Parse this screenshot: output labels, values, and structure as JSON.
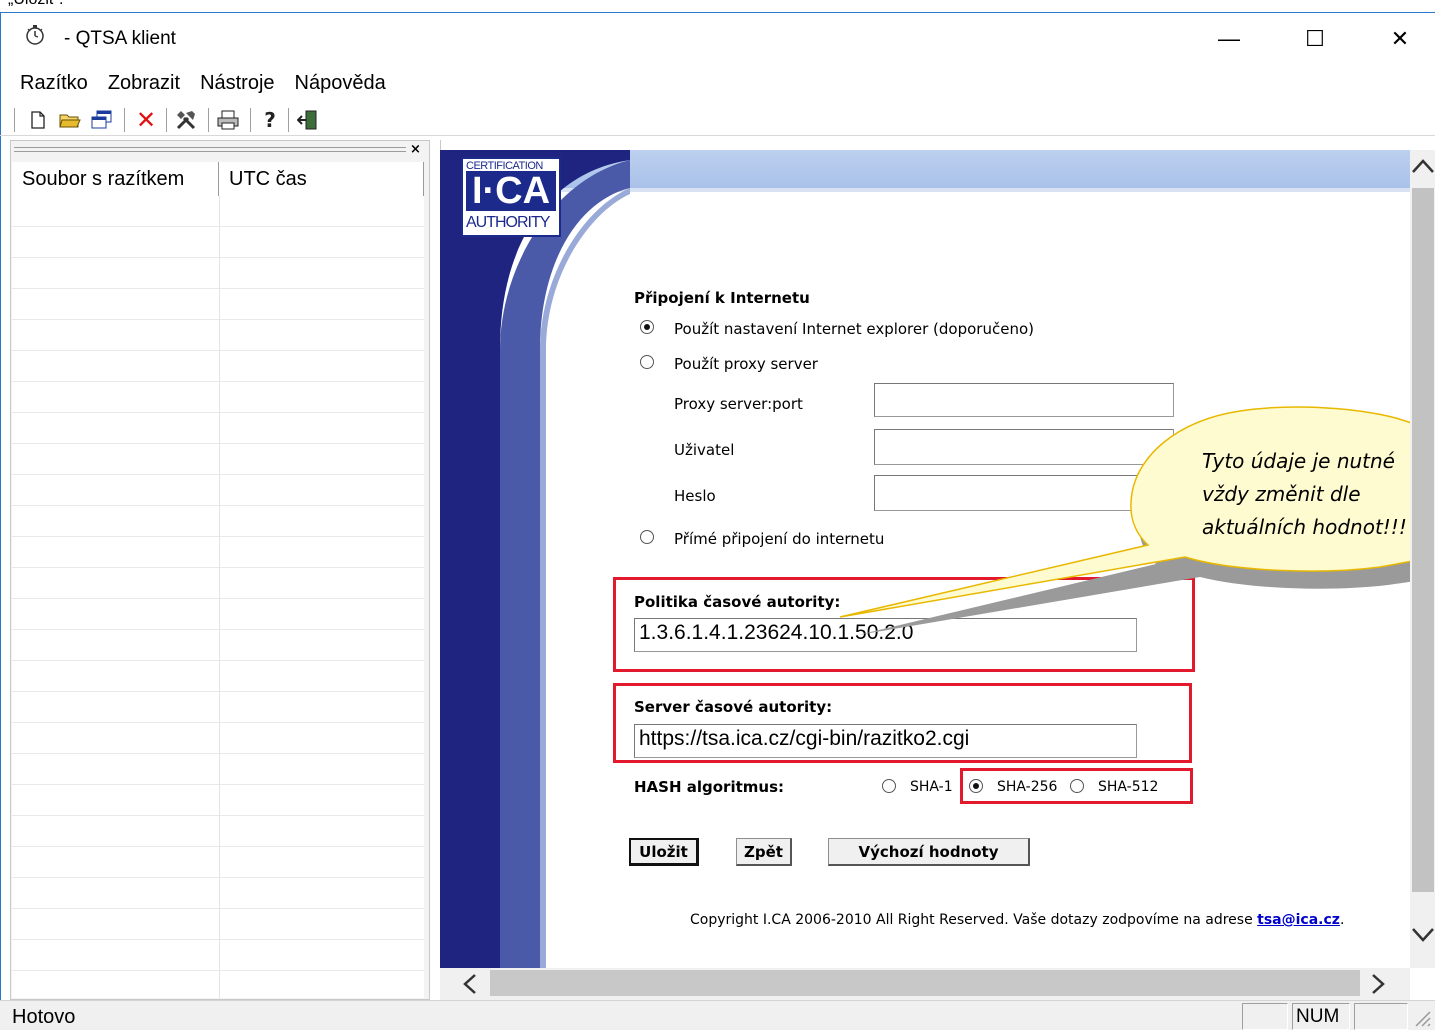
{
  "top_caption": "„Uložit\".",
  "window": {
    "title": "- QTSA klient",
    "controls": {
      "minimize": "—",
      "maximize": "☐",
      "close": "✕"
    }
  },
  "menu": [
    "Razítko",
    "Zobrazit",
    "Nástroje",
    "Nápověda"
  ],
  "toolbar_icons": [
    "new-document-icon",
    "open-folder-icon",
    "windows-icon",
    "delete-icon",
    "tools-icon",
    "print-icon",
    "help-icon",
    "exit-icon"
  ],
  "left_pane": {
    "close_label": "×",
    "columns": [
      "Soubor s razítkem",
      "UTC čas"
    ]
  },
  "logo": {
    "line1": "CERTIFICATION",
    "line2": "I·CA",
    "line3": "AUTHORITY"
  },
  "form": {
    "connection_heading": "Připojení k Internetu",
    "radio_ie": "Použít nastavení Internet explorer (doporučeno)",
    "radio_proxy": "Použít proxy server",
    "proxy_label": "Proxy server:port",
    "user_label": "Uživatel",
    "password_label": "Heslo",
    "radio_direct": "Přímé připojení do internetu",
    "selected_connection": "ie",
    "policy_label": "Politika časové autority:",
    "policy_value": "1.3.6.1.4.1.23624.10.1.50.2.0",
    "server_label": "Server časové autority:",
    "server_value": "https://tsa.ica.cz/cgi-bin/razitko2.cgi",
    "hash_label": "HASH algoritmus:",
    "hash_options": [
      "SHA-1",
      "SHA-256",
      "SHA-512"
    ],
    "hash_selected": "SHA-256",
    "save_button": "Uložit",
    "back_button": "Zpět",
    "defaults_button": "Výchozí hodnoty",
    "copyright_text": "Copyright I.CA 2006-2010 All Right Reserved. Vaše dotazy zodpovíme na adrese ",
    "copyright_email": "tsa@ica.cz",
    "copyright_end": "."
  },
  "callout": {
    "line1": "Tyto údaje je nutné",
    "line2": "vždy změnit dle",
    "line3": "aktuálních hodnot!!!"
  },
  "status": {
    "text": "Hotovo",
    "num": "NUM"
  },
  "colors": {
    "accent_blue": "#1c2a8c",
    "highlight_red": "#e3192d",
    "callout_fill": "#fffbd0",
    "callout_stroke": "#e8b800"
  }
}
